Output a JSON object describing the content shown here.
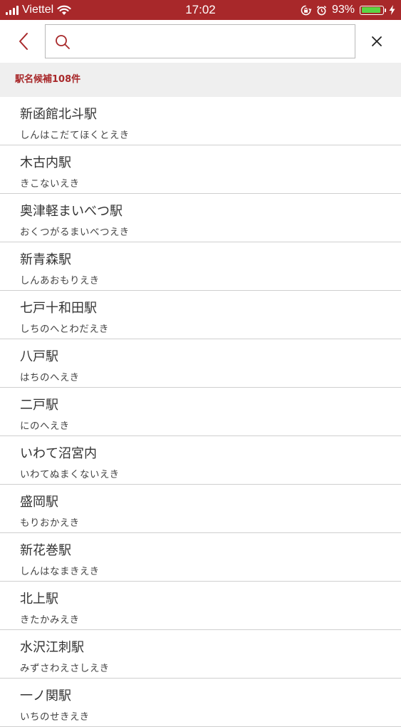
{
  "status_bar": {
    "carrier": "Viettel",
    "time": "17:02",
    "battery_percent": "93%",
    "battery_level": 0.93,
    "icons": [
      "signal-icon",
      "wifi-icon",
      "rotation-lock-icon",
      "alarm-icon",
      "battery-icon",
      "charging-icon"
    ]
  },
  "search": {
    "value": "",
    "placeholder": ""
  },
  "results": {
    "header": "駅名候補108件"
  },
  "stations": [
    {
      "name": "新函館北斗駅",
      "kana": "しんはこだてほくとえき"
    },
    {
      "name": "木古内駅",
      "kana": "きこないえき"
    },
    {
      "name": "奥津軽まいべつ駅",
      "kana": "おくつがるまいべつえき"
    },
    {
      "name": "新青森駅",
      "kana": "しんあおもりえき"
    },
    {
      "name": "七戸十和田駅",
      "kana": "しちのへとわだえき"
    },
    {
      "name": "八戸駅",
      "kana": "はちのへえき"
    },
    {
      "name": "二戸駅",
      "kana": "にのへえき"
    },
    {
      "name": "いわて沼宮内",
      "kana": "いわてぬまくないえき"
    },
    {
      "name": "盛岡駅",
      "kana": "もりおかえき"
    },
    {
      "name": "新花巻駅",
      "kana": "しんはなまきえき"
    },
    {
      "name": "北上駅",
      "kana": "きたかみえき"
    },
    {
      "name": "水沢江刺駅",
      "kana": "みずさわえさしえき"
    },
    {
      "name": "一ノ関駅",
      "kana": "いちのせきえき"
    }
  ],
  "colors": {
    "accent": "#a8282a",
    "header_bg": "#efefef",
    "divider": "#cfcfcf",
    "battery": "#5ad543"
  }
}
